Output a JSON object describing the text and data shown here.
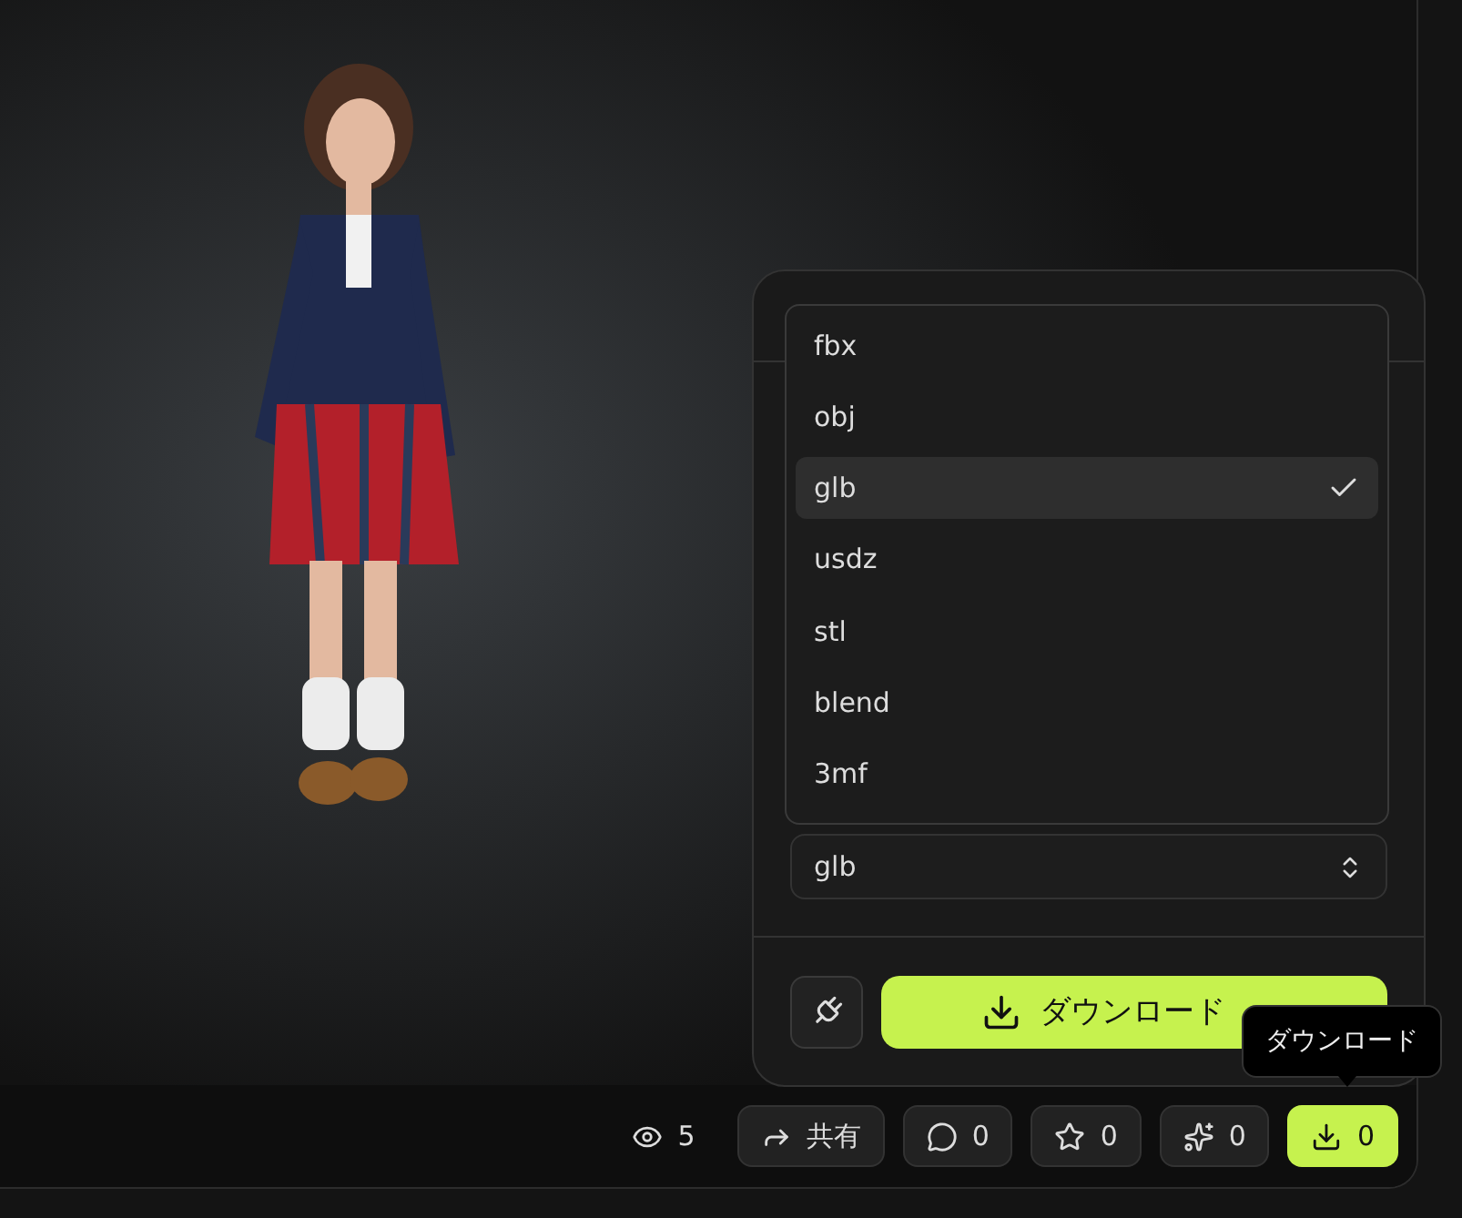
{
  "format_menu": {
    "options": [
      {
        "label": "fbx",
        "selected": false
      },
      {
        "label": "obj",
        "selected": false
      },
      {
        "label": "glb",
        "selected": true
      },
      {
        "label": "usdz",
        "selected": false
      },
      {
        "label": "stl",
        "selected": false
      },
      {
        "label": "blend",
        "selected": false
      },
      {
        "label": "3mf",
        "selected": false
      }
    ]
  },
  "format_select": {
    "value": "glb"
  },
  "download_button": {
    "label": "ダウンロード"
  },
  "tooltip": {
    "text": "ダウンロード"
  },
  "stats": [
    {
      "kind": "views",
      "text": "5",
      "selected": false
    },
    {
      "kind": "share",
      "text": "共有",
      "selected": false
    },
    {
      "kind": "comments",
      "text": "0",
      "selected": false
    },
    {
      "kind": "stars",
      "text": "0",
      "selected": false
    },
    {
      "kind": "remix",
      "text": "0",
      "selected": false
    },
    {
      "kind": "download",
      "text": "0",
      "selected": true
    }
  ]
}
